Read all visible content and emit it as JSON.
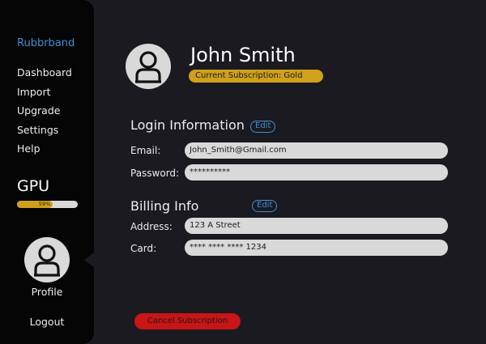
{
  "sidebar": {
    "brand": "Rubbrband",
    "items": [
      {
        "label": "Dashboard"
      },
      {
        "label": "Import"
      },
      {
        "label": "Upgrade"
      },
      {
        "label": "Settings"
      },
      {
        "label": "Help"
      }
    ],
    "gpu": {
      "label": "GPU",
      "percent_text": "59%",
      "percent": 59
    },
    "profile_label": "Profile",
    "logout_label": "Logout"
  },
  "profile": {
    "name": "John Smith",
    "subscription": "Current Subscription: Gold"
  },
  "login": {
    "title": "Login Information",
    "edit_label": "Edit",
    "email_label": "Email:",
    "email_value": "John_Smith@Gmail.com",
    "password_label": "Password:",
    "password_value": "**********"
  },
  "billing": {
    "title": "Billing Info",
    "edit_label": "Edit",
    "address_label": "Address:",
    "address_value": "123 A Street",
    "card_label": "Card:",
    "card_value": "**** **** **** 1234"
  },
  "actions": {
    "cancel_label": "Cancel Subscription"
  },
  "colors": {
    "accent_blue": "#3f8fd3",
    "gold": "#cfa01a",
    "danger": "#c81515",
    "background": "#1b1a21",
    "sidebar": "#050505"
  }
}
